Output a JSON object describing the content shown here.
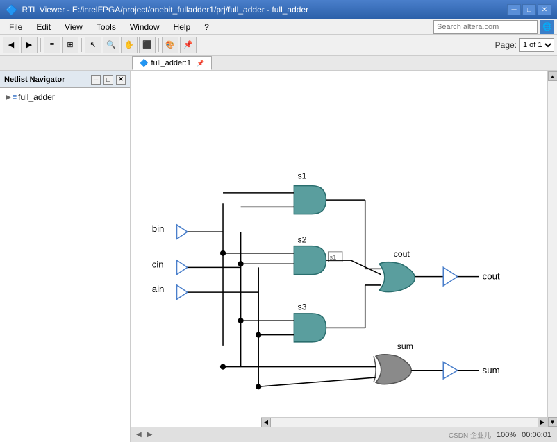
{
  "titleBar": {
    "title": "RTL Viewer - E:/intelFPGA/project/onebit_fulladder1/prj/full_adder - full_adder",
    "icon": "🔷"
  },
  "menuBar": {
    "items": [
      "File",
      "Edit",
      "View",
      "Tools",
      "Window",
      "Help",
      "?"
    ]
  },
  "toolbar": {
    "buttons": [
      "◀",
      "▶",
      "📋",
      "📊",
      "📐",
      "⬛",
      "🔲",
      "🖼️",
      "📸",
      "🔍"
    ]
  },
  "search": {
    "placeholder": "Search altera.com"
  },
  "page": {
    "label": "Page:",
    "value": "1 of 1"
  },
  "tabs": {
    "items": [
      {
        "label": "full_adder:1",
        "icon": "🔷",
        "active": true
      }
    ]
  },
  "sidebar": {
    "title": "Netlist Navigator",
    "buttons": [
      "-",
      "□",
      "x"
    ],
    "tree": [
      {
        "label": "full_adder",
        "type": "module",
        "expanded": false
      }
    ]
  },
  "circuit": {
    "inputs": [
      "bin",
      "cin",
      "ain"
    ],
    "outputs": [
      "cout",
      "sum"
    ],
    "gates": [
      {
        "id": "s1",
        "type": "AND",
        "label": "s1"
      },
      {
        "id": "s2",
        "type": "AND",
        "label": "s2"
      },
      {
        "id": "s3",
        "type": "AND",
        "label": "s3"
      },
      {
        "id": "cout_gate",
        "type": "OR",
        "label": "cout"
      },
      {
        "id": "sum_gate",
        "type": "XOR",
        "label": "sum"
      }
    ],
    "coutBuffer": "cout",
    "sumBuffer": "sum"
  },
  "statusBar": {
    "zoom": "100%",
    "time": "00:00:01",
    "watermark": "CSDN 企业儿"
  }
}
